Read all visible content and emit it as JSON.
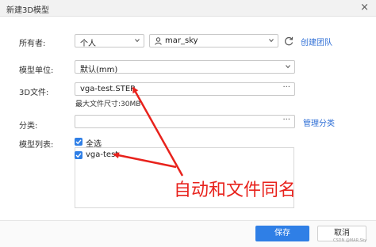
{
  "window": {
    "title": "新建3D模型",
    "close": "×"
  },
  "form": {
    "owner": {
      "label": "所有者:",
      "type_value": "个人",
      "user_value": "mar_sky",
      "create_team_link": "创建团队"
    },
    "unit": {
      "label": "模型单位:",
      "value": "默认(mm)"
    },
    "file": {
      "label": "3D文件:",
      "value": "vga-test.STEP",
      "browse": "···",
      "hint": "最大文件尺寸:30MB"
    },
    "category": {
      "label": "分类:",
      "value": "",
      "browse": "···",
      "manage_link": "管理分类"
    },
    "model_list": {
      "label": "模型列表:",
      "select_all": {
        "label": "全选",
        "checked": true
      },
      "items": [
        {
          "label": "vga-test",
          "checked": true
        }
      ]
    }
  },
  "footer": {
    "save": "保存",
    "cancel": "取消"
  },
  "annotation": {
    "text": "自动和文件同名",
    "color": "#e8221c"
  },
  "watermark": "CSDN @MAR.Sky",
  "colors": {
    "accent": "#2f7fe6",
    "link": "#2f6fd6"
  }
}
